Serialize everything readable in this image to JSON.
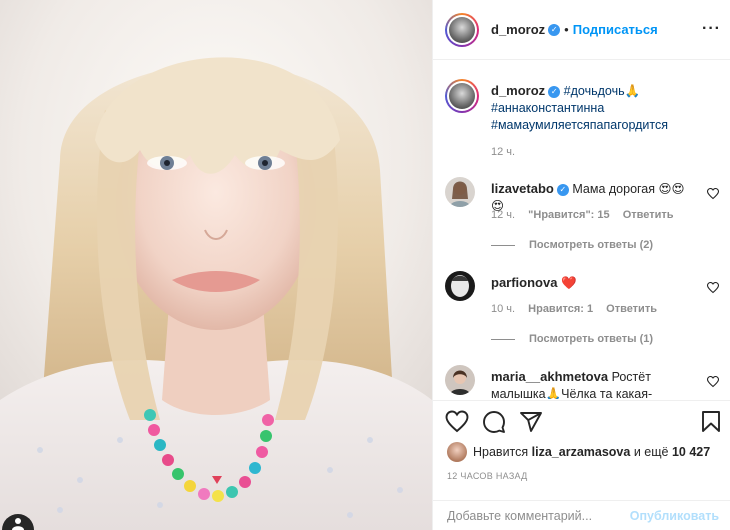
{
  "post": {
    "author": "d_moroz",
    "follow_label": "Подписаться",
    "dot": "•",
    "more_icon": "more-horizontal-icon"
  },
  "caption": {
    "author": "d_moroz",
    "line1": "#дочьдочь🙏",
    "line2": "#аннаконстантинна",
    "line3": "#мамаумиляетсяпапагордится",
    "time": "12 ч."
  },
  "comments": [
    {
      "user": "lizavetabo",
      "verified": true,
      "text": "Мама дорогая 😍😍😍",
      "time": "12 ч.",
      "likes": "\"Нравится\": 15",
      "reply": "Ответить",
      "view_replies": "Посмотреть ответы (2)"
    },
    {
      "user": "parfionova",
      "verified": false,
      "text": "❤️",
      "time": "10 ч.",
      "likes": "Нравится: 1",
      "reply": "Ответить",
      "view_replies": "Посмотреть ответы (1)"
    },
    {
      "user": "maria__akhmetova",
      "verified": false,
      "text": "Ростёт малышка🙏Чёлка та какая-"
    }
  ],
  "liked_by": {
    "prefix": "Нравится",
    "user": "liza_arzamasova",
    "middle": "и ещё",
    "count": "10 427"
  },
  "timestamp": "12 часов назад",
  "add_comment": {
    "placeholder": "Добавьте комментарий...",
    "publish_label": "Опубликовать"
  },
  "colors": {
    "accent": "#0095f6",
    "verified": "#3897f0",
    "muted": "#8e8e8e",
    "publish_disabled": "#b2dffc"
  }
}
